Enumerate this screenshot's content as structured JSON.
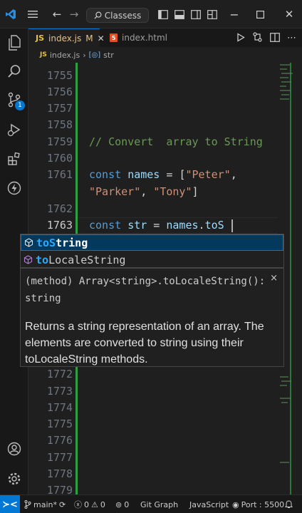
{
  "titlebar": {
    "search_text": "Classess"
  },
  "tabs": [
    {
      "name": "index.js",
      "icon": "JS",
      "modified": "M"
    },
    {
      "name": "index.html",
      "icon": "5"
    }
  ],
  "breadcrumb": {
    "file": "index.js",
    "symbol": "str",
    "file_icon": "JS"
  },
  "activity": {
    "source_control_badge": "1"
  },
  "editor": {
    "lines": [
      {
        "num": "1755",
        "text": ""
      },
      {
        "num": "1756",
        "text": ""
      },
      {
        "num": "1757",
        "text": ""
      },
      {
        "num": "1758",
        "text": ""
      },
      {
        "num": "1759",
        "text": "// Convert  array to String"
      },
      {
        "num": "1760",
        "text": ""
      },
      {
        "num": "1761",
        "text": "const names = [\"Peter\","
      },
      {
        "num": "",
        "text": "\"Parker\", \"Tony\"]"
      },
      {
        "num": "1762",
        "text": ""
      },
      {
        "num": "1763",
        "text": "const str = names.toS"
      },
      {
        "num": "1772",
        "text": ""
      },
      {
        "num": "1773",
        "text": ""
      },
      {
        "num": "1774",
        "text": ""
      },
      {
        "num": "1775",
        "text": ""
      },
      {
        "num": "1776",
        "text": ""
      },
      {
        "num": "1777",
        "text": ""
      },
      {
        "num": "1778",
        "text": ""
      },
      {
        "num": "1779",
        "text": ""
      }
    ],
    "code": {
      "comment": "// Convert  array to String",
      "kw_const": "const",
      "names_var": "names",
      "eq": " = ",
      "arr_open": "[",
      "peter": "\"Peter\"",
      "comma": ",",
      "parker": "\"Parker\"",
      "comma2": ", ",
      "tony": "\"Tony\"",
      "arr_close": "]",
      "str_var": "str",
      "names2": "names",
      "dot": ".",
      "typed": "toS"
    }
  },
  "suggest": {
    "items": [
      {
        "match": "toS",
        "rest": "tring"
      },
      {
        "match": "to",
        "rest": "LocaleString"
      }
    ]
  },
  "details": {
    "signature": "(method) Array<string>.toLocaleString(): string",
    "doc": "Returns a string representation of an array. The elements are converted to string using their toLocaleString methods.",
    "close": "×"
  },
  "statusbar": {
    "branch": "main*",
    "errors": "0",
    "warnings": "0",
    "ports": "0",
    "git_graph": "Git Graph",
    "language": "JavaScript",
    "port": "Port : 5500"
  },
  "colors": {
    "accent": "#0078d4",
    "git_added": "#2ea043",
    "comment": "#6a9955",
    "keyword": "#569cd6",
    "string": "#ce9178",
    "variable": "#9cdcfe"
  }
}
